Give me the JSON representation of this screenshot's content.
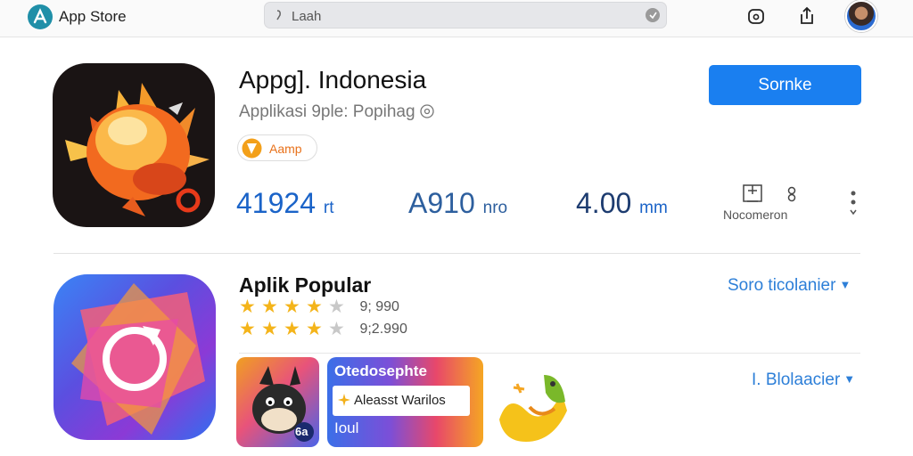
{
  "topbar": {
    "brand": "App Store",
    "search_placeholder": "Laah",
    "icons": [
      "app-store-logo-icon",
      "search-icon",
      "mic-icon",
      "home-icon",
      "share-icon"
    ]
  },
  "app": {
    "title": "Appg]. Indonesia",
    "subtitle": "Applikasi 9ple: Popihag",
    "badge": "Aamp",
    "action_label": "Sornke",
    "stats": [
      {
        "value": "41924",
        "unit": "rt"
      },
      {
        "value": "A910",
        "unit": "nro"
      },
      {
        "value": "4.00",
        "unit": "mm"
      }
    ],
    "stat_label": "Nocomeron",
    "colors": {
      "accent": "#1a7ff0",
      "stat_blue": "#1a63c8",
      "badge_orange": "#e8711a"
    }
  },
  "popular": {
    "title": "Aplik Popular",
    "ratings": [
      {
        "stars": 4,
        "count": "9; 990"
      },
      {
        "stars": 4,
        "count": "9;2.990"
      }
    ],
    "sort_link": "Soro ticolanier",
    "second_link": "I. Blolaacier",
    "screenshot_header": "Otedosephte",
    "screenshot_card": "Aleasst Warilos",
    "screenshot_footer": "Ioul",
    "thumb1_badge": "6a"
  }
}
